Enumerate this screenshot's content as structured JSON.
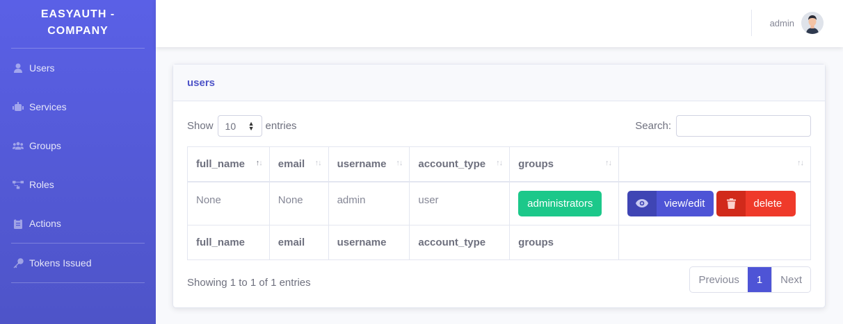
{
  "app": {
    "brand_line1": "EASYAUTH -",
    "brand_line2": "COMPANY"
  },
  "sidebar": {
    "items": [
      {
        "label": "Users",
        "icon": "user-icon"
      },
      {
        "label": "Services",
        "icon": "robot-icon"
      },
      {
        "label": "Groups",
        "icon": "users-icon"
      },
      {
        "label": "Roles",
        "icon": "network-icon"
      },
      {
        "label": "Actions",
        "icon": "clipboard-icon"
      },
      {
        "label": "Tokens Issued",
        "icon": "key-icon"
      }
    ]
  },
  "topbar": {
    "username": "admin"
  },
  "card": {
    "title": "users"
  },
  "controls": {
    "show_label": "Show",
    "entries_value": "10",
    "entries_label": "entries",
    "search_label": "Search:",
    "search_value": ""
  },
  "table": {
    "columns": [
      "full_name",
      "email",
      "username",
      "account_type",
      "groups",
      ""
    ],
    "rows": [
      {
        "full_name": "None",
        "email": "None",
        "username": "admin",
        "account_type": "user",
        "groups": "administrators",
        "view_label": "view/edit",
        "delete_label": "delete"
      }
    ]
  },
  "footer": {
    "info": "Showing 1 to 1 of 1 entries",
    "prev": "Previous",
    "page": "1",
    "next": "Next"
  },
  "colors": {
    "sidebar": "#4e54c8",
    "accent": "#4e54d6",
    "success": "#1cc88a",
    "danger": "#ef3a2a"
  }
}
